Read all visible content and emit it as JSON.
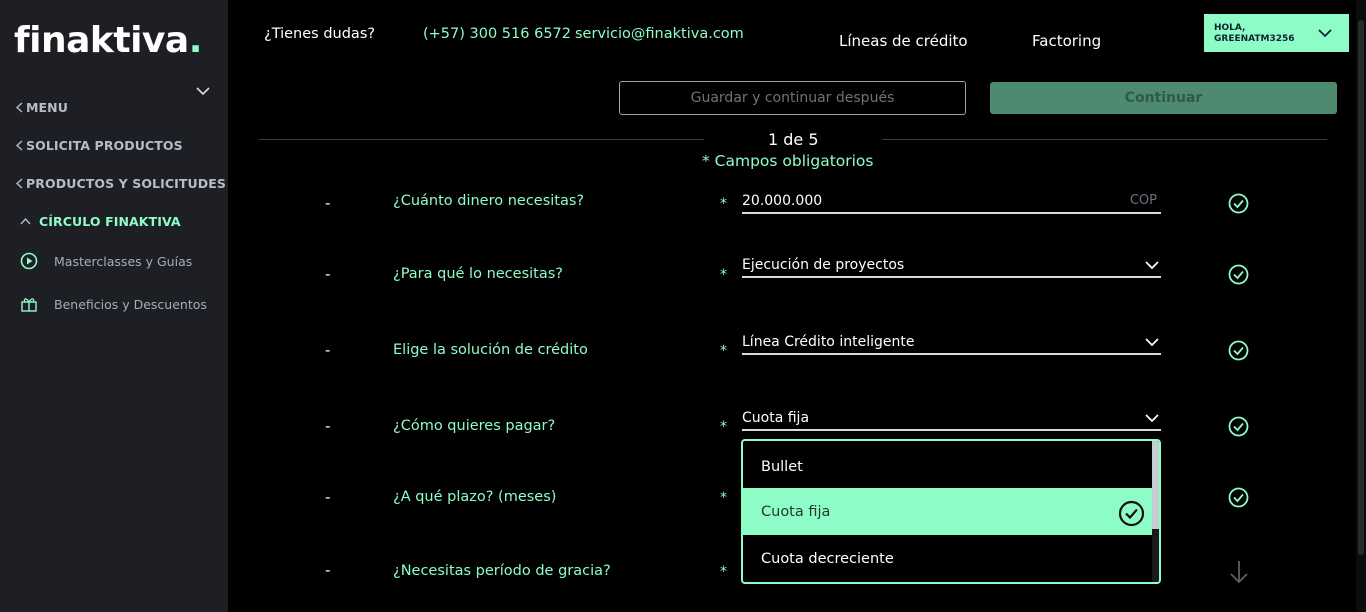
{
  "brand": {
    "logo": "finaktiva",
    "logo_dot": "."
  },
  "sidebar": {
    "items": [
      {
        "label": "MENU"
      },
      {
        "label": "SOLICITA PRODUCTOS"
      },
      {
        "label": "PRODUCTOS Y SOLICITUDES"
      },
      {
        "label": "CÍRCULO FINAKTIVA"
      }
    ],
    "subitems": [
      {
        "label": "Masterclasses y Guías",
        "icon": "play-circle-icon"
      },
      {
        "label": "Beneficios y Descuentos",
        "icon": "gift-icon"
      }
    ]
  },
  "header": {
    "question": "¿Tienes dudas?",
    "phone": "(+57) 300 516 6572",
    "email": "servicio@finaktiva.com",
    "nav": [
      "Líneas de crédito",
      "Factoring"
    ],
    "user_greeting": "HOLA,",
    "user_name": "GREENATM3256"
  },
  "actions": {
    "save_label": "Guardar y continuar después",
    "continue_label": "Continuar"
  },
  "form": {
    "step": "1 de 5",
    "required_note": "* Campos obligatorios",
    "rows": [
      {
        "dash": "-",
        "label": "¿Cuánto dinero necesitas?",
        "star": "*",
        "value": "20.000.000",
        "unit": "COP"
      },
      {
        "dash": "-",
        "label": "¿Para qué lo necesitas?",
        "star": "*",
        "value": "Ejecución de proyectos"
      },
      {
        "dash": "-",
        "label": "Elige la solución de crédito",
        "star": "*",
        "value": "Línea Crédito inteligente"
      },
      {
        "dash": "-",
        "label": "¿Cómo quieres pagar?",
        "star": "*",
        "value": "Cuota fija"
      },
      {
        "dash": "-",
        "label": "¿A qué plazo? (meses)",
        "star": "*",
        "value": ""
      },
      {
        "dash": "-",
        "label": "¿Necesitas período de gracia?",
        "star": "*",
        "value": ""
      }
    ],
    "dropdown_options": [
      "Bullet",
      "Cuota fija",
      "Cuota decreciente"
    ],
    "dropdown_selected": "Cuota fija"
  },
  "colors": {
    "accent": "#8efcc7",
    "sidebar_bg": "#1e1f24",
    "page_bg": "#000000",
    "continue_bg": "#4d8a70"
  }
}
